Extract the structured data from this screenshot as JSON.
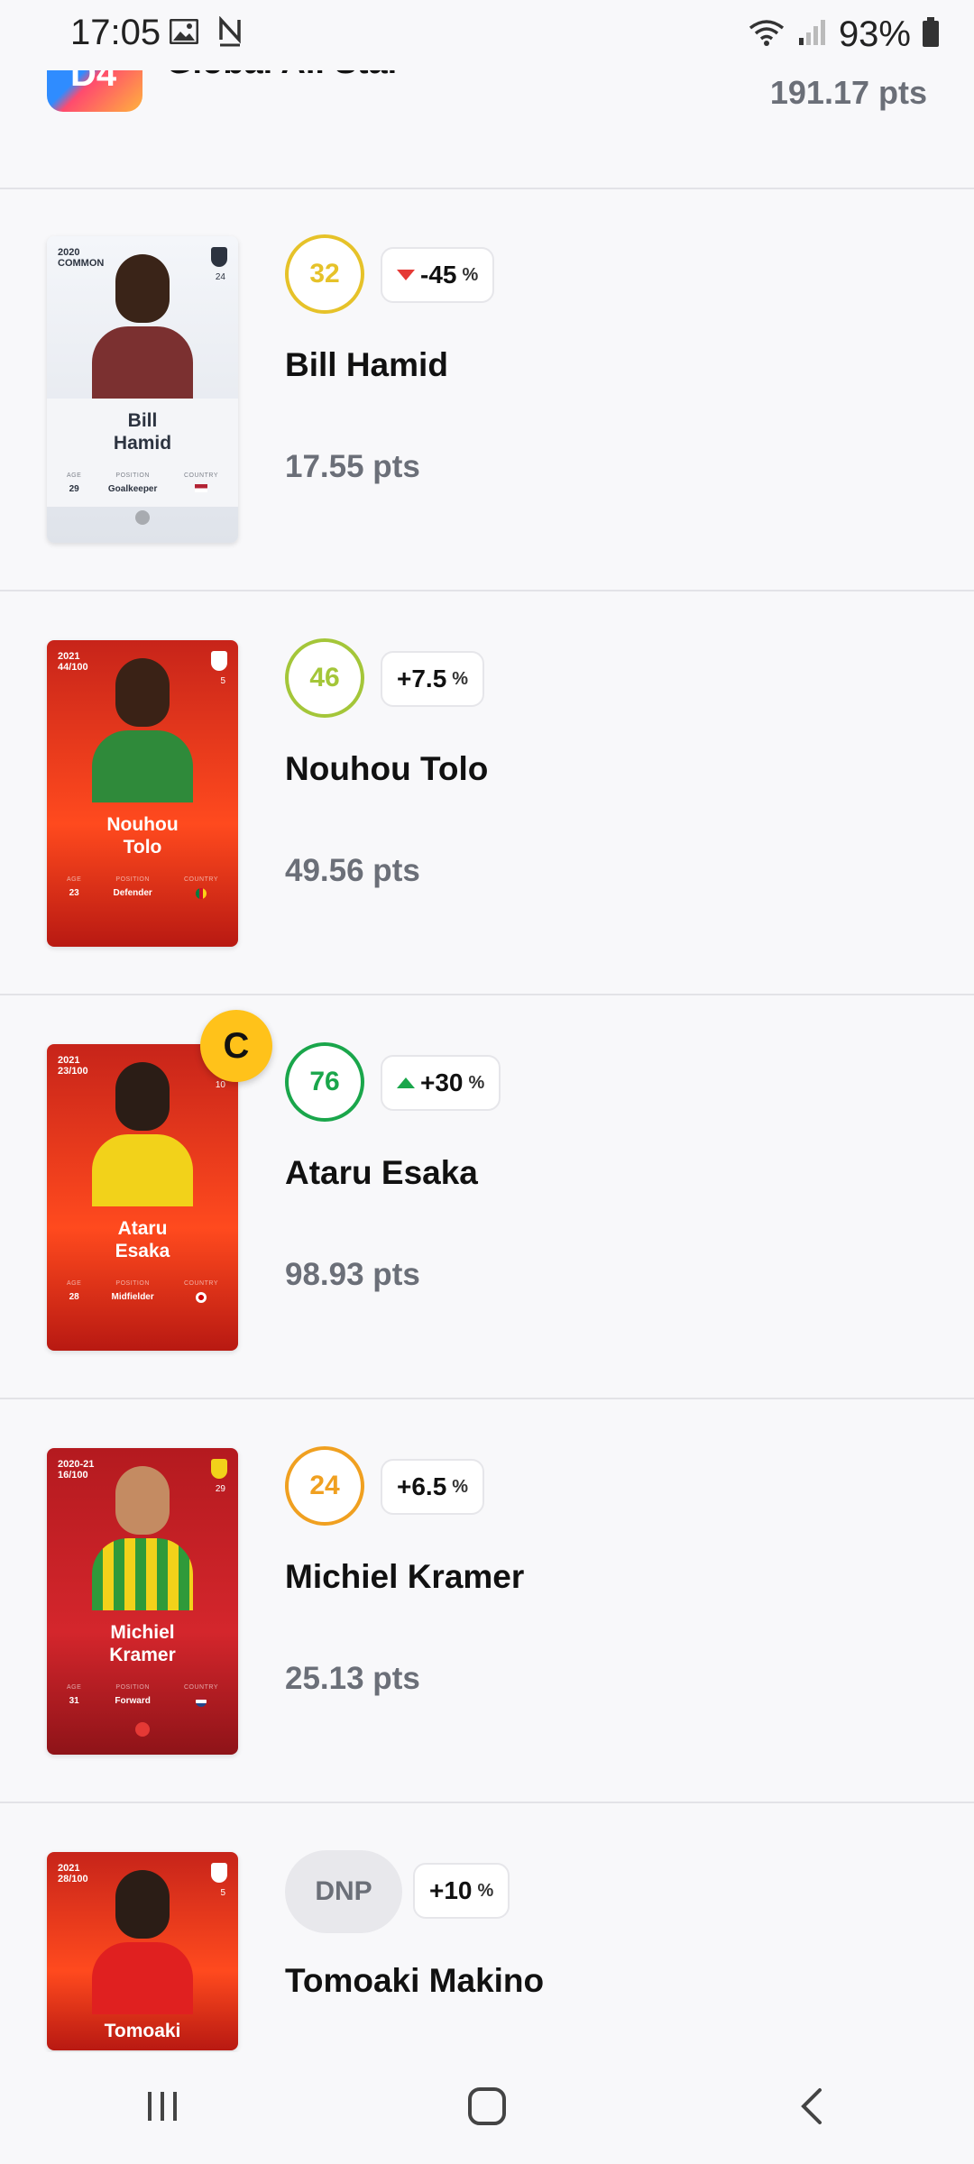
{
  "status_bar": {
    "time": "17:05",
    "battery": "93%",
    "icons": [
      "image-icon",
      "n-notification-icon",
      "wifi-icon",
      "signal-icon",
      "battery-icon"
    ]
  },
  "header": {
    "league_logo_text": "D4",
    "league_name": "Global All Star",
    "total_points": "191.17 pts"
  },
  "players": [
    {
      "name": "Bill Hamid",
      "card_name_line1": "Bill",
      "card_name_line2": "Hamid",
      "card_season": "2020",
      "card_rarity": "COMMON",
      "card_number": "24",
      "age": "29",
      "position": "Goalkeeper",
      "score": "32",
      "score_color": "#e6c229",
      "delta": "-45",
      "delta_direction": "down",
      "points": "17.55 pts",
      "captain": false
    },
    {
      "name": "Nouhou Tolo",
      "card_name_line1": "Nouhou",
      "card_name_line2": "Tolo",
      "card_season": "2021",
      "card_rarity": "44/100",
      "card_number": "5",
      "age": "23",
      "position": "Defender",
      "score": "46",
      "score_color": "#a4c639",
      "delta": "+7.5",
      "delta_direction": "none",
      "points": "49.56 pts",
      "captain": false
    },
    {
      "name": "Ataru Esaka",
      "card_name_line1": "Ataru",
      "card_name_line2": "Esaka",
      "card_season": "2021",
      "card_rarity": "23/100",
      "card_number": "10",
      "age": "28",
      "position": "Midfielder",
      "score": "76",
      "score_color": "#1aa64b",
      "delta": "+30",
      "delta_direction": "up",
      "points": "98.93 pts",
      "captain": true,
      "captain_label": "C"
    },
    {
      "name": "Michiel Kramer",
      "card_name_line1": "Michiel",
      "card_name_line2": "Kramer",
      "card_season": "2020-21",
      "card_rarity": "16/100",
      "card_number": "29",
      "age": "31",
      "position": "Forward",
      "score": "24",
      "score_color": "#f0a020",
      "delta": "+6.5",
      "delta_direction": "none",
      "points": "25.13 pts",
      "captain": false
    },
    {
      "name": "Tomoaki Makino",
      "card_name_line1": "Tomoaki",
      "card_name_line2": "",
      "card_season": "2021",
      "card_rarity": "28/100",
      "card_number": "5",
      "score": "DNP",
      "delta": "+10",
      "delta_direction": "none",
      "captain": false
    }
  ],
  "card_labels": {
    "age": "AGE",
    "position": "POSITION",
    "country": "COUNTRY"
  },
  "pct_symbol": "%",
  "nav": {
    "icons": [
      "recent-apps-icon",
      "home-icon",
      "back-icon"
    ]
  }
}
